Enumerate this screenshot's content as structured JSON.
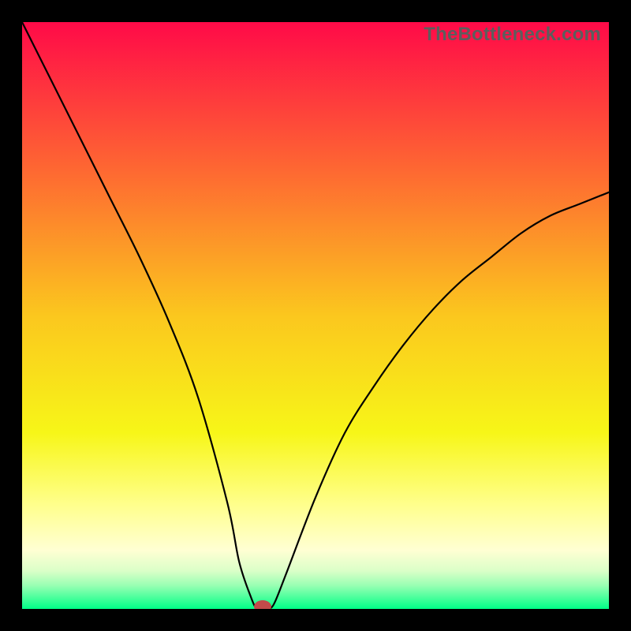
{
  "watermark": "TheBottleneck.com",
  "chart_data": {
    "type": "line",
    "title": "",
    "xlabel": "",
    "ylabel": "",
    "xlim": [
      0,
      100
    ],
    "ylim": [
      0,
      100
    ],
    "grid": false,
    "legend": false,
    "annotations": [],
    "series": [
      {
        "name": "curve",
        "x": [
          0,
          5,
          10,
          15,
          20,
          25,
          30,
          35,
          37,
          39,
          40,
          41,
          42,
          43,
          45,
          50,
          55,
          60,
          65,
          70,
          75,
          80,
          85,
          90,
          95,
          100
        ],
        "y": [
          100,
          90,
          80,
          70,
          60,
          49,
          36,
          18,
          8,
          2,
          0,
          0,
          0,
          1,
          6,
          19,
          30,
          38,
          45,
          51,
          56,
          60,
          64,
          67,
          69,
          71
        ]
      }
    ],
    "marker": {
      "x": 41,
      "y": 0,
      "color": "#c24a4a"
    },
    "gradient_stops": [
      {
        "offset": 0.0,
        "color": "#ff0a48"
      },
      {
        "offset": 0.25,
        "color": "#fe6732"
      },
      {
        "offset": 0.5,
        "color": "#fbc71e"
      },
      {
        "offset": 0.7,
        "color": "#f7f618"
      },
      {
        "offset": 0.82,
        "color": "#ffff8a"
      },
      {
        "offset": 0.9,
        "color": "#ffffd3"
      },
      {
        "offset": 0.935,
        "color": "#dbffc8"
      },
      {
        "offset": 0.96,
        "color": "#99ffb3"
      },
      {
        "offset": 1.0,
        "color": "#00ff87"
      }
    ]
  }
}
